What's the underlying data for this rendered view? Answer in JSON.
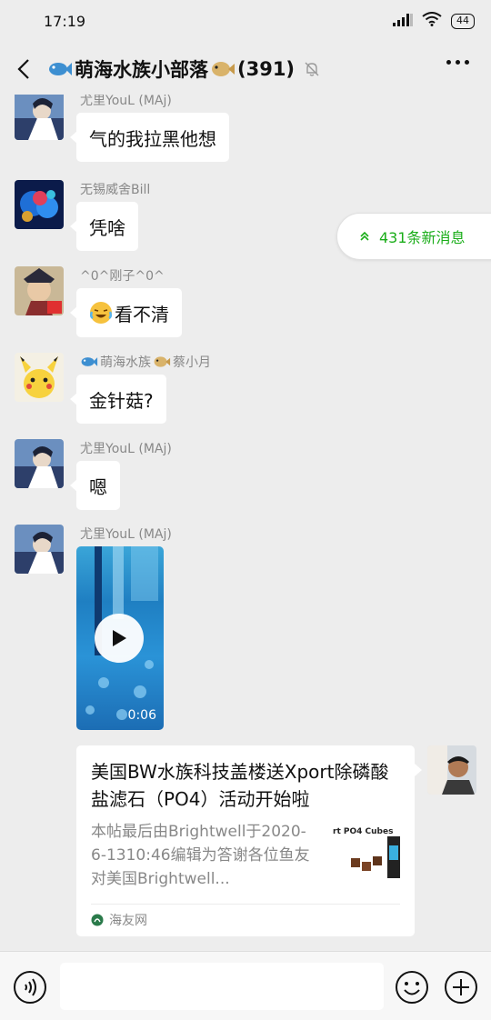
{
  "status_bar": {
    "time": "17:19",
    "battery": "44"
  },
  "header": {
    "title": "萌海水族小部落",
    "member_count": "(391)"
  },
  "new_messages": {
    "label": "431条新消息"
  },
  "messages": [
    {
      "sender": "尤里YouL (MAj)",
      "text": "气的我拉黑他想"
    },
    {
      "sender": "无锡威舍Bill",
      "text": "凭啥"
    },
    {
      "sender": "^0^刚子^0^",
      "text": "看不清"
    },
    {
      "sender_prefix": "萌海水族",
      "sender_suffix": "蔡小月",
      "text": "金针菇?"
    },
    {
      "sender": "尤里YouL (MAj)",
      "text": "嗯"
    },
    {
      "sender": "尤里YouL (MAj)",
      "video_duration": "0:06"
    }
  ],
  "link_card": {
    "title": "美国BW水族科技盖楼送Xport除磷酸盐滤石（PO4）活动开始啦",
    "description": "本帖最后由Brightwell于2020-6-1310:46编辑为答谢各位鱼友对美国Brightwell...",
    "thumbnail_text": "rt PO4 Cubes",
    "source": "海友网"
  }
}
